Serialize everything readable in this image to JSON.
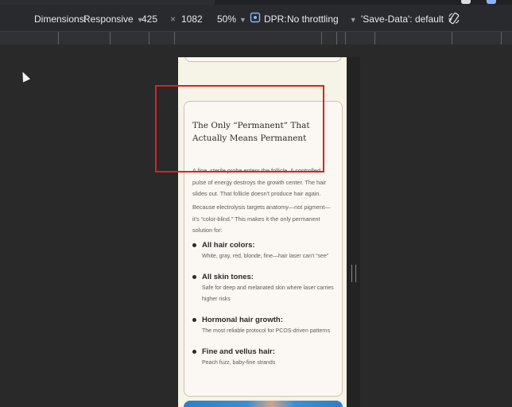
{
  "devtools": {
    "dimensions_label": "Dimensions:",
    "device": "Responsive",
    "width": "425",
    "times": "×",
    "height": "1082",
    "zoom": "50%",
    "dpr_label": "DPR:",
    "throttling": "No throttling",
    "save_data": "'Save-Data': default"
  },
  "content": {
    "heading": "The Only “Permanent” That Actually Means Permanent",
    "paragraph1": "A fine, sterile probe enters the follicle. A controlled pulse of energy destroys the growth center. The hair slides out. That follicle doesn't produce hair again.",
    "paragraph2": "Because electrolysis targets anatomy—not pigment—it's “color-blind.” This makes it the only permanent solution for:",
    "items": [
      {
        "title": "All hair colors:",
        "desc": "White, gray, red, blonde, fine—hair laser can't “see”"
      },
      {
        "title": "All skin tones:",
        "desc": "Safe for deep and melanated skin where laser carries higher risks"
      },
      {
        "title": "Hormonal hair growth:",
        "desc": "The most reliable protocol for PCOS-driven patterns"
      },
      {
        "title": "Fine and vellus hair:",
        "desc": "Peach fuzz, baby-fine strands"
      }
    ]
  },
  "colors": {
    "annotation_box": "#d6241e",
    "page_bg": "#f6f3e7",
    "card_bg": "#fbf8f4"
  }
}
